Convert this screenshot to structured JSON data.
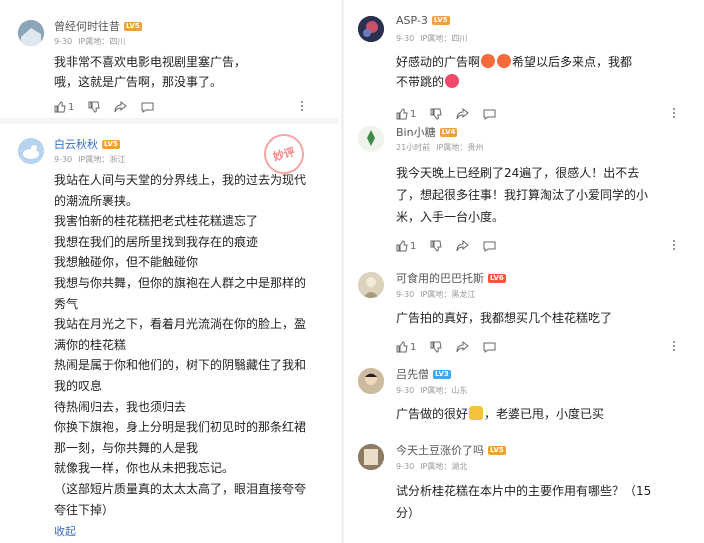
{
  "left": {
    "c1": {
      "name": "曾经何时往昔",
      "level": "LV5",
      "date": "9-30",
      "location": "IP属地：四川",
      "lines": [
        "我非常不喜欢电影电视剧里塞广告，",
        "哦，这就是广告啊，那没事了。"
      ],
      "likes": "1"
    },
    "c2": {
      "name": "白云秋秋",
      "level": "LV5",
      "date": "9-30",
      "location": "IP属地：浙江",
      "stamp": "妙评",
      "lines": [
        "我站在人间与天堂的分界线上，我的过去为现代",
        "的潮流所裹挟。",
        "我害怕新的桂花糕把老式桂花糕遗忘了",
        "我想在我们的居所里找到我存在的痕迹",
        "我想触碰你，但不能触碰你",
        "我想与你共舞，但你的旗袍在人群之中是那样的",
        "秀气",
        "我站在月光之下，看着月光流淌在你的脸上，盈",
        "满你的桂花糕",
        "热闹是属于你和他们的，树下的阴翳藏住了我和",
        "我的叹息",
        "待热闹归去，我也须归去",
        "你换下旗袍，身上分明是我们初见时的那条红裙",
        "那一刻，与你共舞的人是我",
        "就像我一样，你也从未把我忘记。",
        "（这部短片质量真的太太太高了，眼泪直接夸夸",
        "夸往下掉）"
      ],
      "collapse": "收起"
    }
  },
  "right": {
    "c1": {
      "name": "ASP-3",
      "level": "LV5",
      "date": "9-30",
      "location": "IP属地：四川",
      "line1_a": "好感动的广告啊",
      "line1_b": "希望以后多来点，我都",
      "line2": "不带跳的",
      "likes": "1"
    },
    "c2": {
      "name": "Bin小糖",
      "level": "LV4",
      "date": "21小时前",
      "location": "IP属地：贵州",
      "lines": [
        "我今天晚上已经刷了24遍了，很感人！出不去",
        "了，想起很多往事！我打算淘汰了小爱同学的小",
        "米，入手一台小度。"
      ],
      "likes": "1"
    },
    "c3": {
      "name": "可食用的巴巴托斯",
      "level": "LV6",
      "date": "9-30",
      "location": "IP属地：黑龙江",
      "lines": [
        "广告拍的真好，我都想买几个桂花糕吃了"
      ],
      "likes": "1"
    },
    "c4": {
      "name": "吕先僧",
      "level": "LV3",
      "date": "9-30",
      "location": "IP属地：山东",
      "line_a": "广告做的很好",
      "line_b": "，老婆已甩，小度已买"
    },
    "c5": {
      "name": "今天土豆涨价了吗",
      "level": "LV5",
      "date": "9-30",
      "location": "IP属地：湖北",
      "lines": [
        "试分析桂花糕在本片中的主要作用有哪些？（15",
        "分）"
      ]
    }
  },
  "colors": {
    "lv5": "#f0a03c",
    "lv4": "#f0a03c",
    "lv6": "#f5573c",
    "lv3": "#3ca7f0",
    "blue_name": "#3a6ec9",
    "separator": "#f4f4f4"
  }
}
